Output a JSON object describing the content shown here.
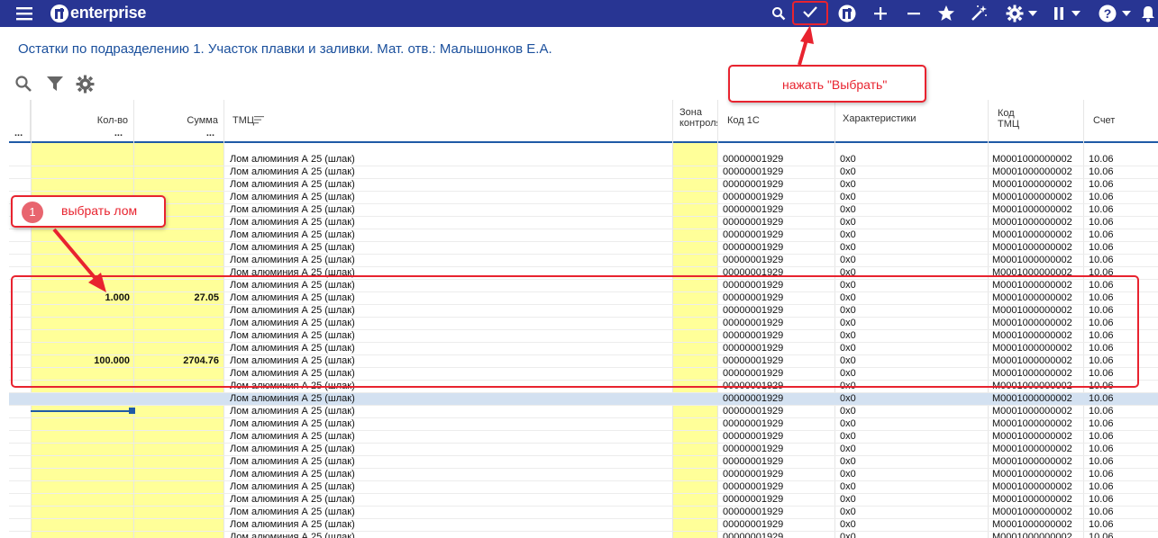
{
  "app": {
    "logo_text": "enterprise",
    "accent": "#283593",
    "title_color": "#1a4f9c"
  },
  "toolbar_icons": [
    "menu-icon",
    "logo-icon",
    "search-icon",
    "check-icon",
    "logo-icon",
    "plus-icon",
    "minus-icon",
    "star-icon",
    "wand-icon",
    "gear-icon",
    "pause-icon",
    "help-icon",
    "bell-icon"
  ],
  "page": {
    "title": "Остатки по подразделению 1. Участок плавки и заливки. Мат. отв.: Малышонков Е.А."
  },
  "columns": {
    "c0": "...",
    "qty": "Кол-во",
    "qty_dots": "...",
    "sum": "Сумма",
    "sum_dots": "...",
    "tmc": "ТМЦ",
    "zone": "Зона контроля",
    "code1c": "Код 1С",
    "chars": "Характеристики",
    "codetmc": "Код ТМЦ",
    "account": "Счет"
  },
  "row_template": {
    "name": "Лом алюминия А 25 (шлак)",
    "code1c": "00000001929",
    "chars": "0x0",
    "codetmc": "M0001000000002",
    "account": "10.06"
  },
  "rows": [
    {
      "qty": "",
      "sum": ""
    },
    {
      "qty": "",
      "sum": ""
    },
    {
      "qty": "",
      "sum": ""
    },
    {
      "qty": "",
      "sum": ""
    },
    {
      "qty": "",
      "sum": ""
    },
    {
      "qty": "",
      "sum": ""
    },
    {
      "qty": "",
      "sum": ""
    },
    {
      "qty": "",
      "sum": ""
    },
    {
      "qty": "",
      "sum": ""
    },
    {
      "qty": "",
      "sum": ""
    },
    {
      "qty": "",
      "sum": ""
    },
    {
      "qty": "1.000",
      "sum": "27.05"
    },
    {
      "qty": "",
      "sum": ""
    },
    {
      "qty": "",
      "sum": ""
    },
    {
      "qty": "",
      "sum": ""
    },
    {
      "qty": "",
      "sum": ""
    },
    {
      "qty": "100.000",
      "sum": "2704.76"
    },
    {
      "qty": "",
      "sum": ""
    },
    {
      "qty": "",
      "sum": ""
    },
    {
      "qty": "",
      "sum": "",
      "selected": true
    },
    {
      "qty": "",
      "sum": ""
    },
    {
      "qty": "",
      "sum": ""
    },
    {
      "qty": "",
      "sum": ""
    },
    {
      "qty": "",
      "sum": ""
    },
    {
      "qty": "",
      "sum": ""
    },
    {
      "qty": "",
      "sum": ""
    },
    {
      "qty": "",
      "sum": ""
    },
    {
      "qty": "",
      "sum": ""
    },
    {
      "qty": "",
      "sum": ""
    },
    {
      "qty": "",
      "sum": ""
    },
    {
      "qty": "",
      "sum": ""
    }
  ],
  "annotations": {
    "step1_number": "1",
    "step1_text": "выбрать лом",
    "select_text": "нажать \"Выбрать\"",
    "color": "#e8232f"
  }
}
